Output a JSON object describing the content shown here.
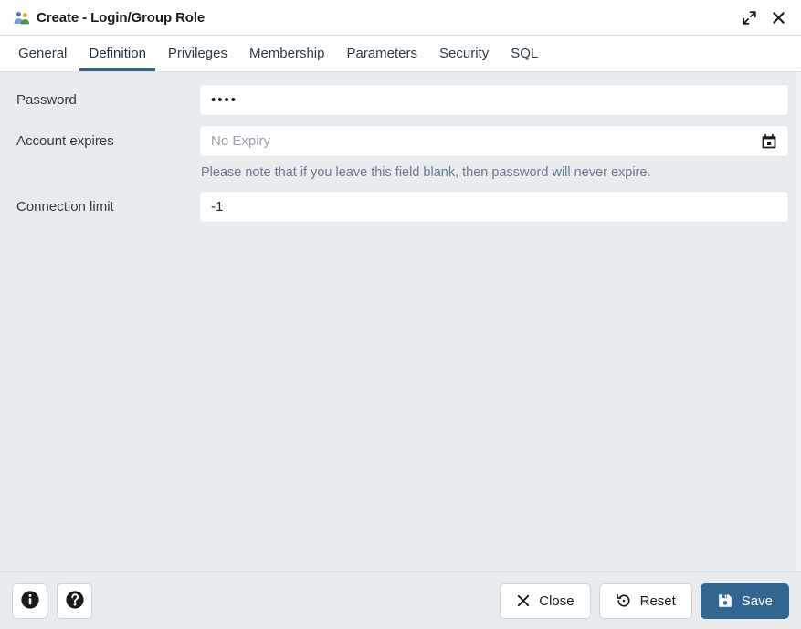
{
  "titlebar": {
    "icon": "group-role-icon",
    "title": "Create - Login/Group Role",
    "maximize_icon": "maximize-icon",
    "close_icon": "close-icon"
  },
  "tabs": [
    {
      "label": "General",
      "active": false
    },
    {
      "label": "Definition",
      "active": true
    },
    {
      "label": "Privileges",
      "active": false
    },
    {
      "label": "Membership",
      "active": false
    },
    {
      "label": "Parameters",
      "active": false
    },
    {
      "label": "Security",
      "active": false
    },
    {
      "label": "SQL",
      "active": false
    }
  ],
  "form": {
    "password": {
      "label": "Password",
      "value": "••••",
      "masked_char_count": 4
    },
    "account_expires": {
      "label": "Account expires",
      "value": "",
      "placeholder": "No Expiry",
      "calendar_icon": "calendar-icon",
      "helper_text": "Please note that if you leave this field blank, then password will never expire."
    },
    "connection_limit": {
      "label": "Connection limit",
      "value": "-1"
    }
  },
  "footer": {
    "info_label": "i",
    "info_icon": "info-icon",
    "help_label": "?",
    "help_icon": "help-icon",
    "close_label": "Close",
    "close_icon": "close-x-icon",
    "reset_label": "Reset",
    "reset_icon": "reset-icon",
    "save_label": "Save",
    "save_icon": "save-floppy-icon"
  },
  "colors": {
    "accent": "#326690",
    "body_bg": "#e9ecef",
    "panel_bg": "#ffffff",
    "helper_text": "#6b7a8d",
    "placeholder": "#9aa2ab"
  }
}
